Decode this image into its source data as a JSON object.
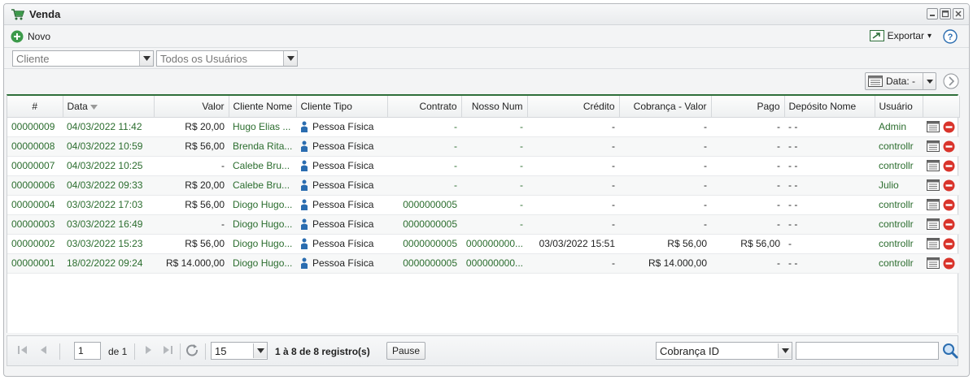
{
  "window": {
    "title": "Venda"
  },
  "toolbar": {
    "new_label": "Novo",
    "export_label": "Exportar",
    "export_caret": "▾"
  },
  "filters": {
    "cliente": "Cliente",
    "usuarios": "Todos os Usuários"
  },
  "view": {
    "label": "Data: -"
  },
  "columns": [
    "#",
    "Data",
    "Valor",
    "Cliente Nome",
    "Cliente Tipo",
    "Contrato",
    "Nosso Num",
    "Crédito",
    "Cobrança - Valor",
    "Pago",
    "Depósito Nome",
    "Usuário"
  ],
  "rows": [
    {
      "id": "00000009",
      "data": "04/03/2022 11:42",
      "valor": "R$ 20,00",
      "cliente": "Hugo Elias ...",
      "tipo": "Pessoa Física",
      "contrato": "-",
      "nosso": "-",
      "credito": "-",
      "cobranca": "-",
      "pago": "-",
      "deposito": "- -",
      "usuario": "Admin"
    },
    {
      "id": "00000008",
      "data": "04/03/2022 10:59",
      "valor": "R$ 56,00",
      "cliente": "Brenda Rita...",
      "tipo": "Pessoa Física",
      "contrato": "-",
      "nosso": "-",
      "credito": "-",
      "cobranca": "-",
      "pago": "-",
      "deposito": "- -",
      "usuario": "controllr"
    },
    {
      "id": "00000007",
      "data": "04/03/2022 10:25",
      "valor": "-",
      "cliente": "Calebe Bru...",
      "tipo": "Pessoa Física",
      "contrato": "-",
      "nosso": "-",
      "credito": "-",
      "cobranca": "-",
      "pago": "-",
      "deposito": "- -",
      "usuario": "controllr"
    },
    {
      "id": "00000006",
      "data": "04/03/2022 09:33",
      "valor": "R$ 20,00",
      "cliente": "Calebe Bru...",
      "tipo": "Pessoa Física",
      "contrato": "-",
      "nosso": "-",
      "credito": "-",
      "cobranca": "-",
      "pago": "-",
      "deposito": "- -",
      "usuario": "Julio"
    },
    {
      "id": "00000004",
      "data": "03/03/2022 17:03",
      "valor": "R$ 56,00",
      "cliente": "Diogo Hugo...",
      "tipo": "Pessoa Física",
      "contrato": "0000000005",
      "nosso": "-",
      "credito": "-",
      "cobranca": "-",
      "pago": "-",
      "deposito": "- -",
      "usuario": "controllr"
    },
    {
      "id": "00000003",
      "data": "03/03/2022 16:49",
      "valor": "-",
      "cliente": "Diogo Hugo...",
      "tipo": "Pessoa Física",
      "contrato": "0000000005",
      "nosso": "-",
      "credito": "-",
      "cobranca": "-",
      "pago": "-",
      "deposito": "- -",
      "usuario": "controllr"
    },
    {
      "id": "00000002",
      "data": "03/03/2022 15:23",
      "valor": "R$ 56,00",
      "cliente": "Diogo Hugo...",
      "tipo": "Pessoa Física",
      "contrato": "0000000005",
      "nosso": "000000000...",
      "credito": "03/03/2022 15:51",
      "cobranca": "R$ 56,00",
      "pago": "R$ 56,00",
      "deposito": "-",
      "usuario": "controllr"
    },
    {
      "id": "00000001",
      "data": "18/02/2022 09:24",
      "valor": "R$ 14.000,00",
      "cliente": "Diogo Hugo...",
      "tipo": "Pessoa Física",
      "contrato": "0000000005",
      "nosso": "000000000...",
      "credito": "-",
      "cobranca": "R$ 14.000,00",
      "pago": "-",
      "deposito": "- -",
      "usuario": "controllr"
    }
  ],
  "pager": {
    "page": "1",
    "of": "de 1",
    "page_size": "15",
    "info": "1 à 8 de 8 registro(s)",
    "pause": "Pause",
    "search_field": "Cobrança ID",
    "search_value": ""
  },
  "colors": {
    "accent": "#2e6f3a",
    "link": "#2b6d2e",
    "delete": "#d9342b"
  }
}
